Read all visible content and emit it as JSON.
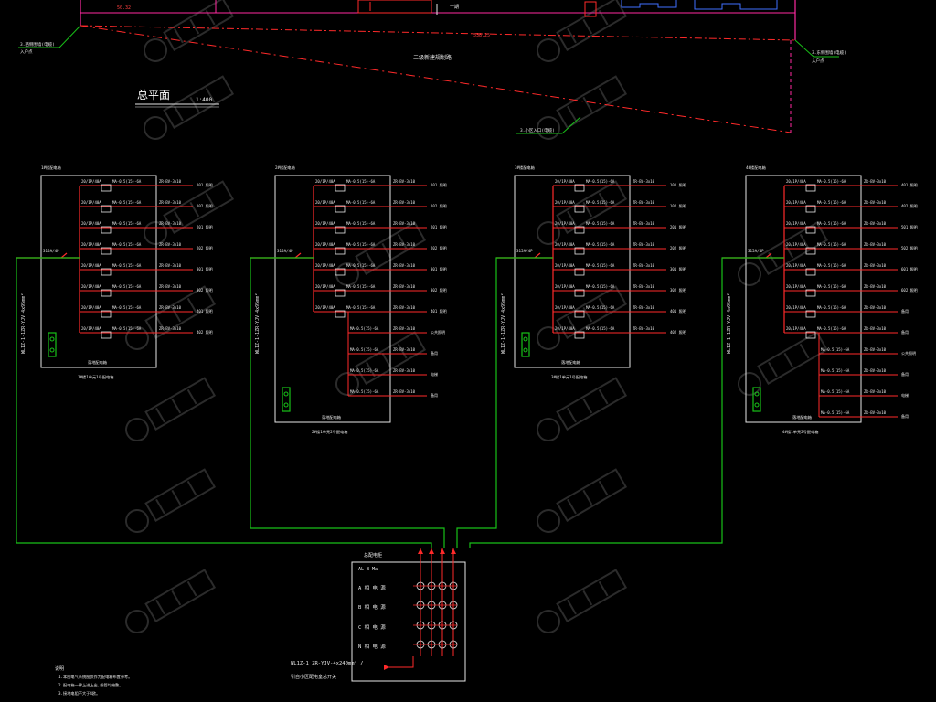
{
  "site_plan": {
    "title": "总平面",
    "scale": "1:400",
    "road_label": "二级新建规划路",
    "segment_label_left": "50.32",
    "segment_label_mid": "538.25",
    "building_label": "一期"
  },
  "panels": [
    {
      "id": "panel-1",
      "header": "1#楼配电箱",
      "caption": "1#楼1单元1号配电箱",
      "feeder_label": "WL1Z-1-1ZR-YJV-4x95mm²",
      "main_breaker": "315A/4P",
      "bottom_label": "落地配电箱",
      "out_rows": [
        {
          "breaker": "20/1P/40A",
          "rcd": "MA-0.5(15)-6A",
          "cable": "ZR-BV-3x10",
          "dest": "101 照明"
        },
        {
          "breaker": "20/1P/40A",
          "rcd": "MA-0.5(15)-6A",
          "cable": "ZR-BV-3x10",
          "dest": "102 照明"
        },
        {
          "breaker": "20/1P/40A",
          "rcd": "MA-0.5(15)-6A",
          "cable": "ZR-BV-3x10",
          "dest": "201 照明"
        },
        {
          "breaker": "20/1P/40A",
          "rcd": "MA-0.5(15)-6A",
          "cable": "ZR-BV-3x10",
          "dest": "202 照明"
        },
        {
          "breaker": "20/1P/40A",
          "rcd": "MA-0.5(15)-6A",
          "cable": "ZR-BV-3x10",
          "dest": "301 照明"
        },
        {
          "breaker": "20/1P/40A",
          "rcd": "MA-0.5(15)-6A",
          "cable": "ZR-BV-3x10",
          "dest": "302 照明"
        },
        {
          "breaker": "20/1P/40A",
          "rcd": "MA-0.5(15)-6A",
          "cable": "ZR-BV-3x10",
          "dest": "401 照明"
        },
        {
          "breaker": "20/1P/40A",
          "rcd": "MA-0.5(15)-6A",
          "cable": "ZR-BV-3x10",
          "dest": "402 照明"
        }
      ],
      "extra_rows": []
    },
    {
      "id": "panel-2",
      "header": "2#楼配电箱",
      "caption": "2#楼1单元2号配电箱",
      "feeder_label": "WL1Z-1-1ZR-YJV-4x95mm²",
      "main_breaker": "315A/4P",
      "bottom_label": "落地配电箱",
      "out_rows": [
        {
          "breaker": "20/1P/40A",
          "rcd": "MA-0.5(15)-6A",
          "cable": "ZR-BV-3x10",
          "dest": "101 照明"
        },
        {
          "breaker": "20/1P/40A",
          "rcd": "MA-0.5(15)-6A",
          "cable": "ZR-BV-3x10",
          "dest": "102 照明"
        },
        {
          "breaker": "20/1P/40A",
          "rcd": "MA-0.5(15)-6A",
          "cable": "ZR-BV-3x10",
          "dest": "201 照明"
        },
        {
          "breaker": "20/1P/40A",
          "rcd": "MA-0.5(15)-6A",
          "cable": "ZR-BV-3x10",
          "dest": "202 照明"
        },
        {
          "breaker": "20/1P/40A",
          "rcd": "MA-0.5(15)-6A",
          "cable": "ZR-BV-3x10",
          "dest": "301 照明"
        },
        {
          "breaker": "20/1P/40A",
          "rcd": "MA-0.5(15)-6A",
          "cable": "ZR-BV-3x10",
          "dest": "302 照明"
        },
        {
          "breaker": "20/1P/40A",
          "rcd": "MA-0.5(15)-6A",
          "cable": "ZR-BV-3x10",
          "dest": "401 照明"
        }
      ],
      "extra_rows": [
        {
          "rcd": "MA-0.5(15)-6A",
          "cable": "ZR-BV-3x10",
          "dest": "公共照明"
        },
        {
          "rcd": "MA-0.5(15)-6A",
          "cable": "ZR-BV-3x10",
          "dest": "备用"
        },
        {
          "rcd": "MA-0.5(15)-6A",
          "cable": "ZR-BV-3x10",
          "dest": "电梯"
        },
        {
          "rcd": "MA-0.5(15)-6A",
          "cable": "ZR-BV-3x10",
          "dest": "备用"
        }
      ]
    },
    {
      "id": "panel-3",
      "header": "3#楼配电箱",
      "caption": "3#楼1单元1号配电箱",
      "feeder_label": "WL1Z-1-1ZR-YJV-4x95mm²",
      "main_breaker": "315A/4P",
      "bottom_label": "落地配电箱",
      "out_rows": [
        {
          "breaker": "20/1P/40A",
          "rcd": "MA-0.5(15)-6A",
          "cable": "ZR-BV-3x10",
          "dest": "101 照明"
        },
        {
          "breaker": "20/1P/40A",
          "rcd": "MA-0.5(15)-6A",
          "cable": "ZR-BV-3x10",
          "dest": "102 照明"
        },
        {
          "breaker": "20/1P/40A",
          "rcd": "MA-0.5(15)-6A",
          "cable": "ZR-BV-3x10",
          "dest": "201 照明"
        },
        {
          "breaker": "20/1P/40A",
          "rcd": "MA-0.5(15)-6A",
          "cable": "ZR-BV-3x10",
          "dest": "202 照明"
        },
        {
          "breaker": "20/1P/40A",
          "rcd": "MA-0.5(15)-6A",
          "cable": "ZR-BV-3x10",
          "dest": "301 照明"
        },
        {
          "breaker": "20/1P/40A",
          "rcd": "MA-0.5(15)-6A",
          "cable": "ZR-BV-3x10",
          "dest": "302 照明"
        },
        {
          "breaker": "20/1P/40A",
          "rcd": "MA-0.5(15)-6A",
          "cable": "ZR-BV-3x10",
          "dest": "401 照明"
        },
        {
          "breaker": "20/1P/40A",
          "rcd": "MA-0.5(15)-6A",
          "cable": "ZR-BV-3x10",
          "dest": "402 照明"
        }
      ],
      "extra_rows": []
    },
    {
      "id": "panel-4",
      "header": "4#楼配电箱",
      "caption": "4#楼1单元2号配电箱",
      "feeder_label": "WL1Z-1-1ZR-YJV-4x95mm²",
      "main_breaker": "315A/4P",
      "bottom_label": "落地配电箱",
      "out_rows": [
        {
          "breaker": "20/1P/40A",
          "rcd": "MA-0.5(15)-6A",
          "cable": "ZR-BV-3x10",
          "dest": "401 照明"
        },
        {
          "breaker": "20/1P/40A",
          "rcd": "MA-0.5(15)-6A",
          "cable": "ZR-BV-3x10",
          "dest": "402 照明"
        },
        {
          "breaker": "20/1P/40A",
          "rcd": "MA-0.5(15)-6A",
          "cable": "ZR-BV-3x10",
          "dest": "501 照明"
        },
        {
          "breaker": "20/1P/40A",
          "rcd": "MA-0.5(15)-6A",
          "cable": "ZR-BV-3x10",
          "dest": "502 照明"
        },
        {
          "breaker": "20/1P/40A",
          "rcd": "MA-0.5(15)-6A",
          "cable": "ZR-BV-3x10",
          "dest": "601 照明"
        },
        {
          "breaker": "20/1P/40A",
          "rcd": "MA-0.5(15)-6A",
          "cable": "ZR-BV-3x10",
          "dest": "602 照明"
        },
        {
          "breaker": "20/1P/40A",
          "rcd": "MA-0.5(15)-6A",
          "cable": "ZR-BV-3x10",
          "dest": "备用"
        },
        {
          "breaker": "20/1P/40A",
          "rcd": "MA-0.5(15)-6A",
          "cable": "ZR-BV-3x10",
          "dest": "备用"
        }
      ],
      "extra_rows": [
        {
          "rcd": "MA-0.5(15)-6A",
          "cable": "ZR-BV-3x10",
          "dest": "公共照明"
        },
        {
          "rcd": "MA-0.5(15)-6A",
          "cable": "ZR-BV-3x10",
          "dest": "备用"
        },
        {
          "rcd": "MA-0.5(15)-6A",
          "cable": "ZR-BV-3x10",
          "dest": "电梯"
        },
        {
          "rcd": "MA-0.5(15)-6A",
          "cable": "ZR-BV-3x10",
          "dest": "备用"
        }
      ]
    }
  ],
  "main_panel": {
    "header": "总配电柜",
    "sub_header": "AL-B-Ma",
    "rows": [
      "A 相 电 源",
      "B 相 电 源",
      "C 相 电 源",
      "N 相 电 源"
    ],
    "incoming_label": "WL1Z-1 ZR-YJV-4x240mm² /",
    "incoming_sub": "引自小区配电室总开关"
  },
  "notes": [
    "说明",
    "1.本图电气系统图仅作为配电箱布置参考。",
    "2.配电箱一律上进上出,线管均暗敷。",
    "3.接地电阻不大于4欧。"
  ],
  "colors": {
    "background": "#000000",
    "wire_red": "#ff2a2a",
    "wire_green": "#18c018",
    "box_white": "#e6e6e6",
    "annotation_cyan": "#40e0ff",
    "magenta_line": "#ff2aa0"
  }
}
